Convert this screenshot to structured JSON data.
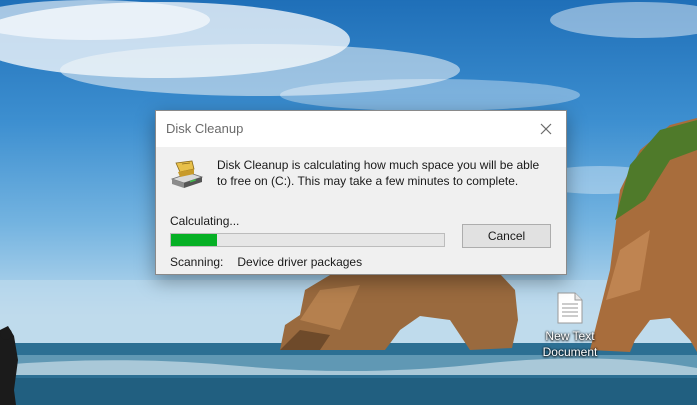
{
  "desktop": {
    "icons": [
      {
        "label": "New Text Document",
        "icon": "text-file-icon"
      }
    ]
  },
  "dialog": {
    "title": "Disk Cleanup",
    "icon": "disk-cleanup-icon",
    "close_icon": "close-icon",
    "message": "Disk Cleanup is calculating how much space you will be able to free on  (C:). This may take a few minutes to complete.",
    "status_label": "Calculating...",
    "progress_fraction": 0.17,
    "progress_color": "#06b025",
    "cancel_label": "Cancel",
    "scanning_label": "Scanning:",
    "scanning_value": "Device driver packages"
  }
}
